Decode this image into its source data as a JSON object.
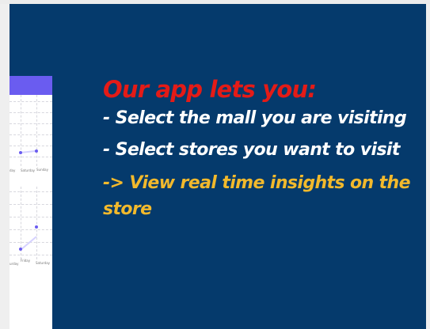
{
  "slide": {
    "headline": "Our app lets you:",
    "bullets": [
      "- Select the mall you are visiting",
      "- Select stores you want to visit"
    ],
    "accent_line": "-> View real time insights on the store",
    "colors": {
      "background": "#053a6c",
      "headline": "#e41b17",
      "bullet_text": "#ffffff",
      "accent_text": "#f2b92c"
    }
  },
  "phone_mockup": {
    "header_color": "#6a5cf0",
    "chart_top_ticks": [
      "day",
      "Saturday",
      "Sunday"
    ],
    "chart_bottom_ticks": [
      "urday",
      "Friday",
      "Saturday"
    ]
  }
}
